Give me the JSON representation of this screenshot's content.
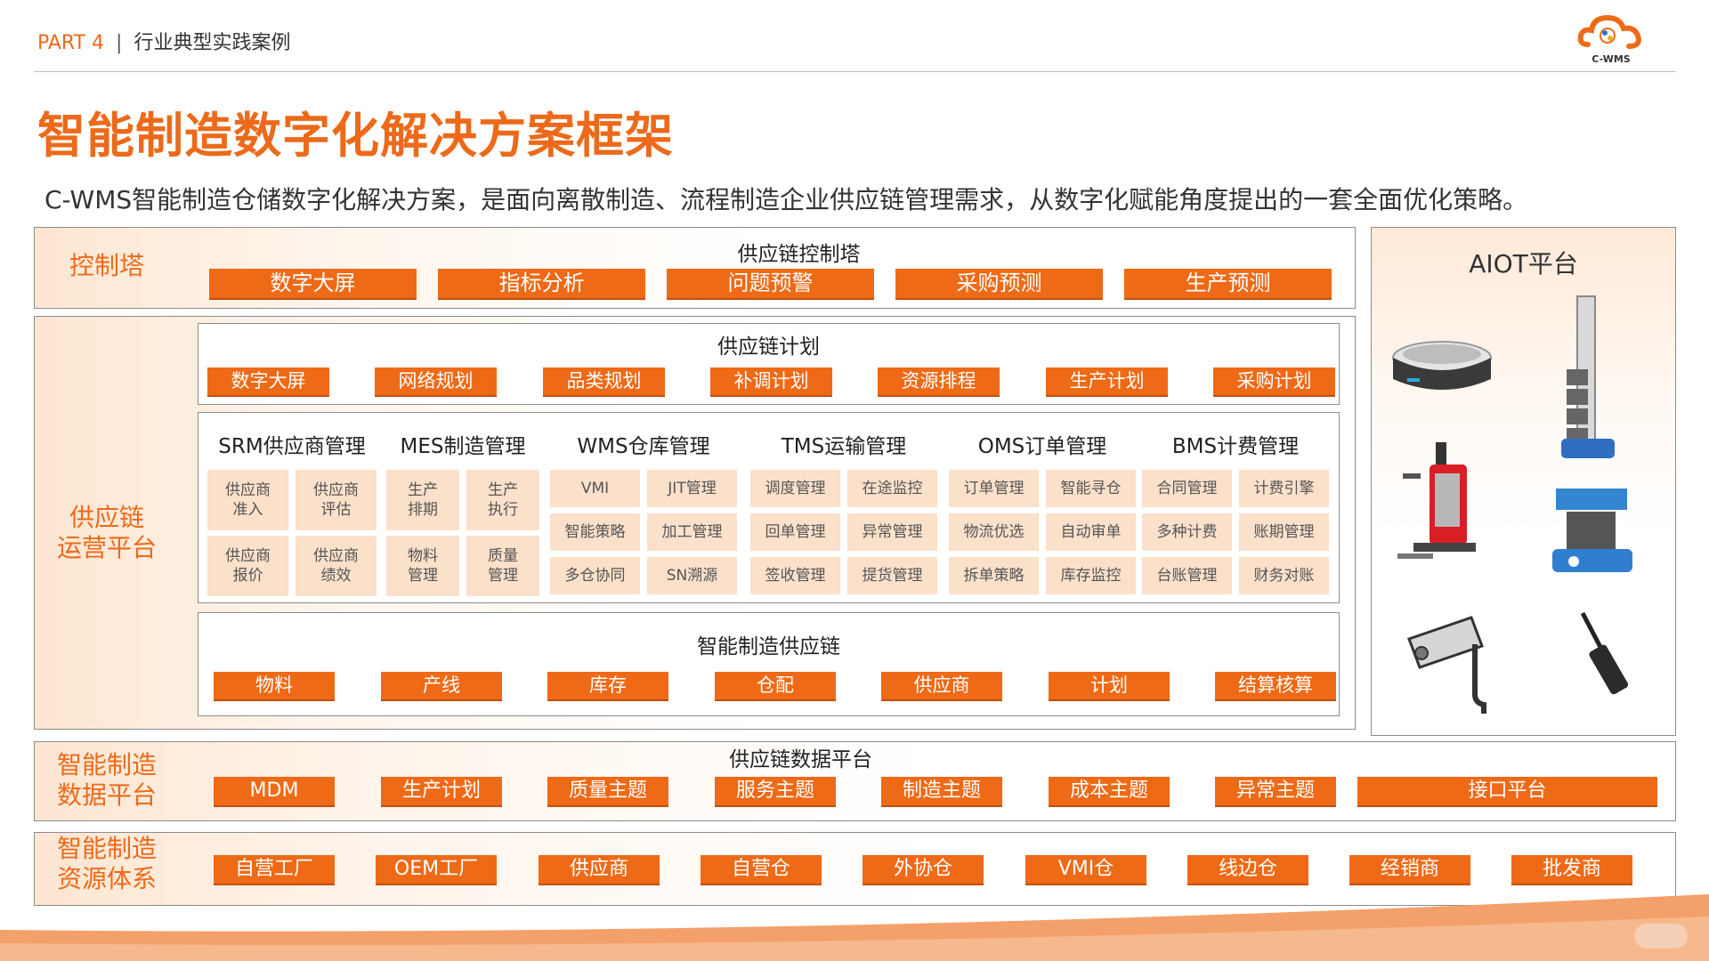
{
  "header": {
    "part_label": "PART 4",
    "separator": "|",
    "section": "行业典型实践案例",
    "logo_text": "C-WMS"
  },
  "title": "智能制造数字化解决方案框架",
  "subtitle": "C-WMS智能制造仓储数字化解决方案，是面向离散制造、流程制造企业供应链管理需求，从数字化赋能角度提出的一套全面优化策略。",
  "control_tower": {
    "label": "控制塔",
    "title": "供应链控制塔",
    "items": [
      "数字大屏",
      "指标分析",
      "问题预警",
      "采购预测",
      "生产预测"
    ]
  },
  "ops_platform": {
    "label_line1": "供应链",
    "label_line2": "运营平台",
    "plan": {
      "title": "供应链计划",
      "items": [
        "数字大屏",
        "网络规划",
        "品类规划",
        "补调计划",
        "资源排程",
        "生产计划",
        "采购计划"
      ]
    },
    "modules": [
      {
        "title": "SRM供应商管理",
        "cells": [
          [
            "供应商",
            "准入"
          ],
          [
            "供应商",
            "评估"
          ],
          [
            "供应商",
            "报价"
          ],
          [
            "供应商",
            "绩效"
          ]
        ]
      },
      {
        "title": "MES制造管理",
        "cells": [
          [
            "生产",
            "排期"
          ],
          [
            "生产",
            "执行"
          ],
          [
            "物料",
            "管理"
          ],
          [
            "质量",
            "管理"
          ]
        ]
      },
      {
        "title": "WMS仓库管理",
        "cells": [
          "VMI",
          "JIT管理",
          "智能策略",
          "加工管理",
          "多仓协同",
          "SN溯源"
        ]
      },
      {
        "title": "TMS运输管理",
        "cells": [
          "调度管理",
          "在途监控",
          "回单管理",
          "异常管理",
          "签收管理",
          "提货管理"
        ]
      },
      {
        "title": "OMS订单管理",
        "cells": [
          "订单管理",
          "智能寻仓",
          "物流优选",
          "自动审单",
          "拆单策略",
          "库存监控"
        ]
      },
      {
        "title": "BMS计费管理",
        "cells": [
          "合同管理",
          "计费引擎",
          "多种计费",
          "账期管理",
          "台账管理",
          "财务对账"
        ]
      }
    ],
    "smart_chain": {
      "title": "智能制造供应链",
      "items": [
        "物料",
        "产线",
        "库存",
        "仓配",
        "供应商",
        "计划",
        "结算核算"
      ]
    }
  },
  "aiot": {
    "title": "AIOT平台"
  },
  "data_platform": {
    "label_line1": "智能制造",
    "label_line2": "数据平台",
    "title": "供应链数据平台",
    "items": [
      "MDM",
      "生产计划",
      "质量主题",
      "服务主题",
      "制造主题",
      "成本主题",
      "异常主题"
    ],
    "wide_item": "接口平台"
  },
  "resource": {
    "label_line1": "智能制造",
    "label_line2": "资源体系",
    "items": [
      "自营工厂",
      "OEM工厂",
      "供应商",
      "自营仓",
      "外协仓",
      "VMI仓",
      "线边仓",
      "经销商",
      "批发商"
    ]
  },
  "colors": {
    "accent": "#ee6a17",
    "cell_bg": "#fbe0ca",
    "border": "#8c8c8c"
  }
}
